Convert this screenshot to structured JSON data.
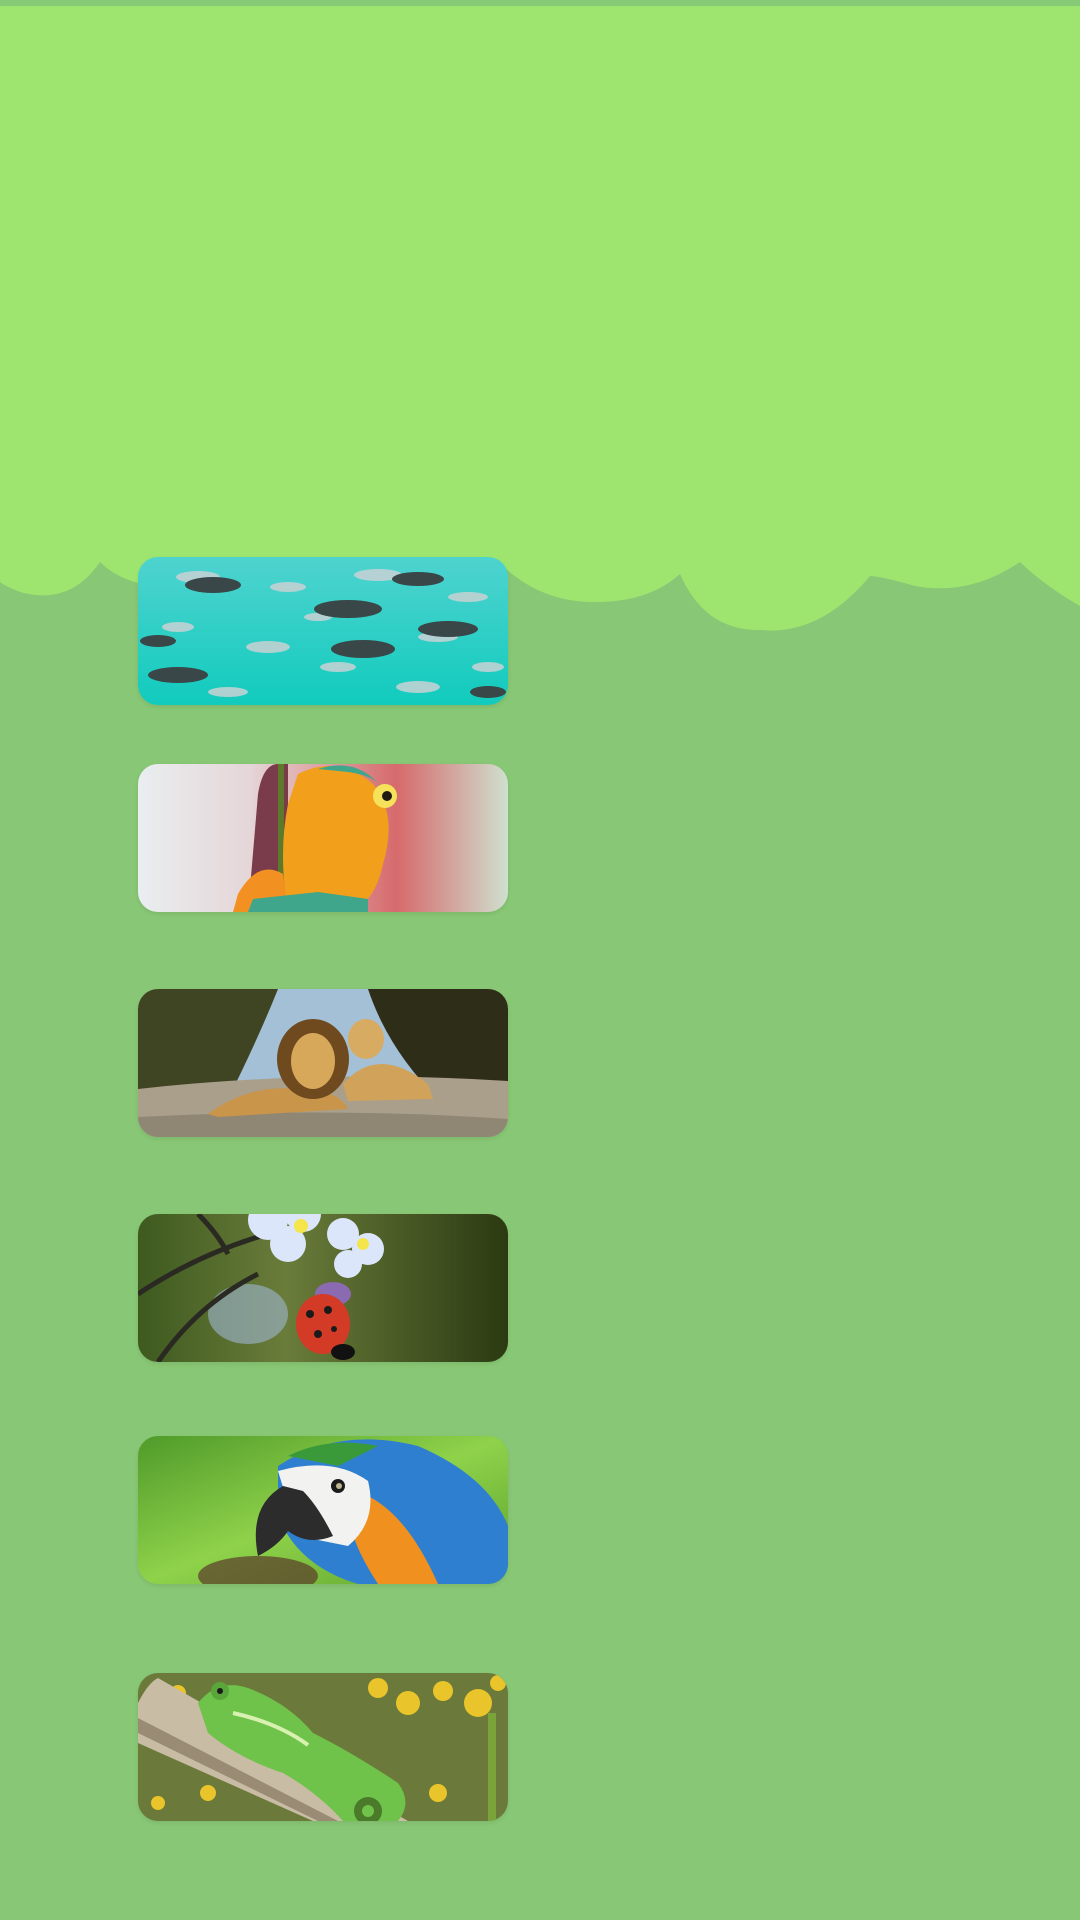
{
  "screen": {
    "background_color": "#88c775",
    "hero_color": "#9ee56f"
  },
  "cards": [
    {
      "subject": "fish-school",
      "colors": [
        "#21d4c8",
        "#3a4a4c",
        "#b9c2c4"
      ]
    },
    {
      "subject": "tree-frog",
      "colors": [
        "#f3a21c",
        "#3fa58b",
        "#d46b6b"
      ]
    },
    {
      "subject": "lions",
      "colors": [
        "#c89a4a",
        "#4b4a2a",
        "#a9a08c"
      ]
    },
    {
      "subject": "ladybug-on-flowers",
      "colors": [
        "#d33b27",
        "#c8d8f5",
        "#3d5a1e"
      ]
    },
    {
      "subject": "macaw-parrot",
      "colors": [
        "#2f7fd0",
        "#f0901f",
        "#5aa33a"
      ]
    },
    {
      "subject": "chameleon",
      "colors": [
        "#6fc24a",
        "#b9a68c",
        "#e9c42a"
      ]
    }
  ]
}
